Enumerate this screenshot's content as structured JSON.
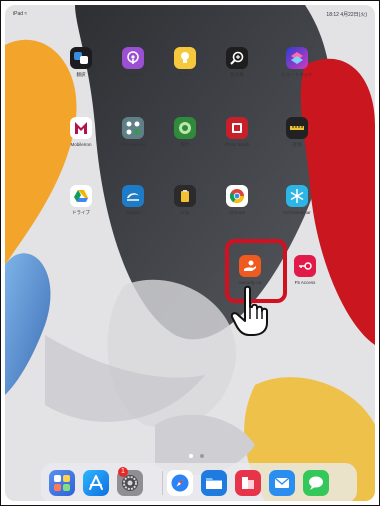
{
  "status": {
    "left": "iPad ≈",
    "right": "18:12  4月22日(火)"
  },
  "apps": [
    {
      "name": "meas-app",
      "label": "翻訳",
      "bg": "#1c1c1e"
    },
    {
      "name": "podcast-app",
      "label": "Podcast",
      "bg": "#9b4fd3"
    },
    {
      "name": "tips-app",
      "label": "ヒント",
      "bg": "#f6c93c"
    },
    {
      "name": "magnifier-app",
      "label": "拡大鏡",
      "bg": "#1e1e1e"
    },
    {
      "name": "shortcuts-app",
      "label": "ショートカット",
      "bg": "#3b5bd6"
    },
    {
      "name": "mobileme-app",
      "label": "MobileIron",
      "bg": "#ffffff"
    },
    {
      "name": "netanalyzer-app",
      "label": "Net Analyzer",
      "bg": "#5f7f86"
    },
    {
      "name": "find-app",
      "label": "探す",
      "bg": "#2f8a3b"
    },
    {
      "name": "photobooth-app",
      "label": "Photo Booth",
      "bg": "#c8202b"
    },
    {
      "name": "tuner-app",
      "label": "計測",
      "bg": "#222222"
    },
    {
      "name": "drive-app",
      "label": "ドライブ",
      "bg": "#ffffff"
    },
    {
      "name": "zscaler-app",
      "label": "Zscaler",
      "bg": "#1d7bc7"
    },
    {
      "name": "clip-app",
      "label": "iClip",
      "bg": "#2b2b2b"
    },
    {
      "name": "chrome-app",
      "label": "Chrome",
      "bg": "#ffffff"
    },
    {
      "name": "gotowebinar-app",
      "label": "GoToWebinar",
      "bg": "#2db5e6"
    },
    {
      "name": "security-app",
      "label": "Security ca",
      "bg": "#ef5a1e"
    },
    {
      "name": "f5-app",
      "label": "F5 Access",
      "bg": "#e11a4a"
    }
  ],
  "dock": {
    "badge_count": "1",
    "apps": [
      "photos",
      "app-store",
      "settings",
      "safari",
      "files",
      "office",
      "mail",
      "messages"
    ]
  }
}
